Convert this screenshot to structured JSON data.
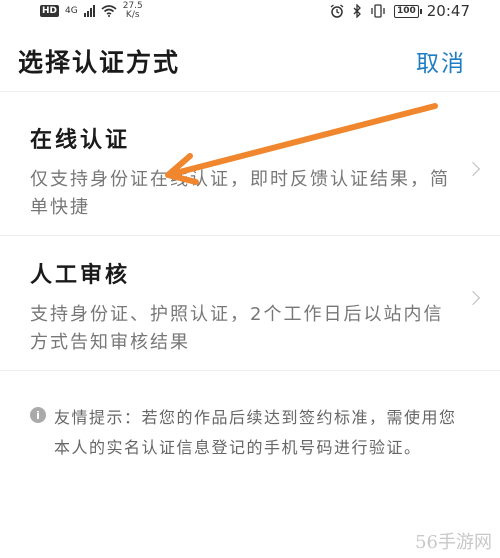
{
  "status_bar": {
    "hd": "HD",
    "network": "4G",
    "speed_value": "27.5",
    "speed_unit": "K/s",
    "battery": "100",
    "time": "20:47"
  },
  "header": {
    "title": "选择认证方式",
    "cancel_label": "取消"
  },
  "options": [
    {
      "title": "在线认证",
      "description": "仅支持身份证在线认证，即时反馈认证结果，简单快捷"
    },
    {
      "title": "人工审核",
      "description": "支持身份证、护照认证，2个工作日后以站内信方式告知审核结果"
    }
  ],
  "tip": {
    "text": "友情提示：若您的作品后续达到签约标准，需使用您本人的实名认证信息登记的手机号码进行验证。"
  },
  "watermark": "56手游网",
  "annotation_color": "#f0862d"
}
